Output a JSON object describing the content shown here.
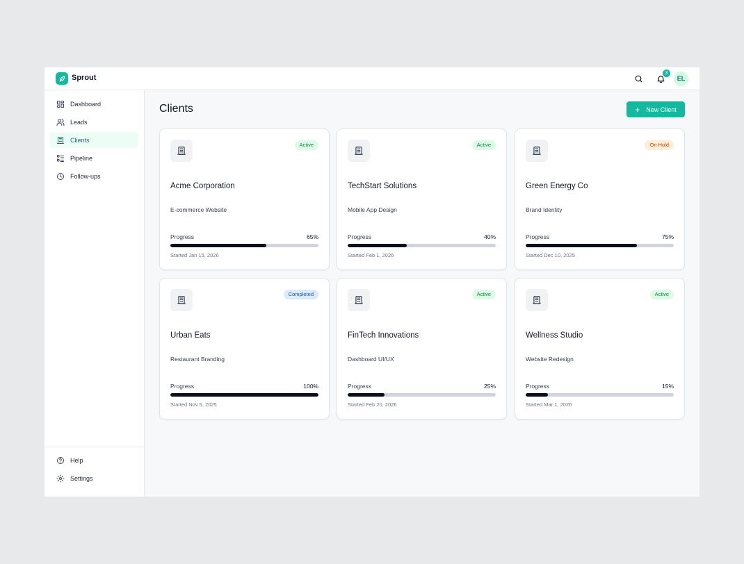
{
  "app": {
    "brand": "Sprout"
  },
  "header": {
    "notification_count": "3",
    "avatar_initials": "EL"
  },
  "sidebar": {
    "items": [
      {
        "label": "Dashboard",
        "icon": "dashboard-icon"
      },
      {
        "label": "Leads",
        "icon": "users-icon"
      },
      {
        "label": "Clients",
        "icon": "building-icon",
        "active": true
      },
      {
        "label": "Pipeline",
        "icon": "list-icon"
      },
      {
        "label": "Follow-ups",
        "icon": "clock-icon"
      }
    ],
    "bottom": [
      {
        "label": "Help",
        "icon": "help-icon"
      },
      {
        "label": "Settings",
        "icon": "gear-icon"
      }
    ]
  },
  "main": {
    "title": "Clients",
    "new_button": "New Client",
    "progress_label": "Progress",
    "clients": [
      {
        "name": "Acme Corporation",
        "project": "E-commerce Website",
        "status": "Active",
        "progress": "65%",
        "progress_value": 65,
        "started": "Started Jan 15, 2026"
      },
      {
        "name": "TechStart Solutions",
        "project": "Mobile App Design",
        "status": "Active",
        "progress": "40%",
        "progress_value": 40,
        "started": "Started Feb 1, 2026"
      },
      {
        "name": "Green Energy Co",
        "project": "Brand Identity",
        "status": "On Hold",
        "progress": "75%",
        "progress_value": 75,
        "started": "Started Dec 10, 2025"
      },
      {
        "name": "Urban Eats",
        "project": "Restaurant Branding",
        "status": "Completed",
        "progress": "100%",
        "progress_value": 100,
        "started": "Started Nov 5, 2025"
      },
      {
        "name": "FinTech Innovations",
        "project": "Dashboard UI/UX",
        "status": "Active",
        "progress": "25%",
        "progress_value": 25,
        "started": "Started Feb 20, 2026"
      },
      {
        "name": "Wellness Studio",
        "project": "Website Redesign",
        "status": "Active",
        "progress": "15%",
        "progress_value": 15,
        "started": "Started Mar 1, 2026"
      }
    ]
  },
  "colors": {
    "accent": "#15b79e",
    "active_badge": "#dcfce7",
    "hold_badge": "#ffedd5",
    "completed_badge": "#dbeafe"
  }
}
